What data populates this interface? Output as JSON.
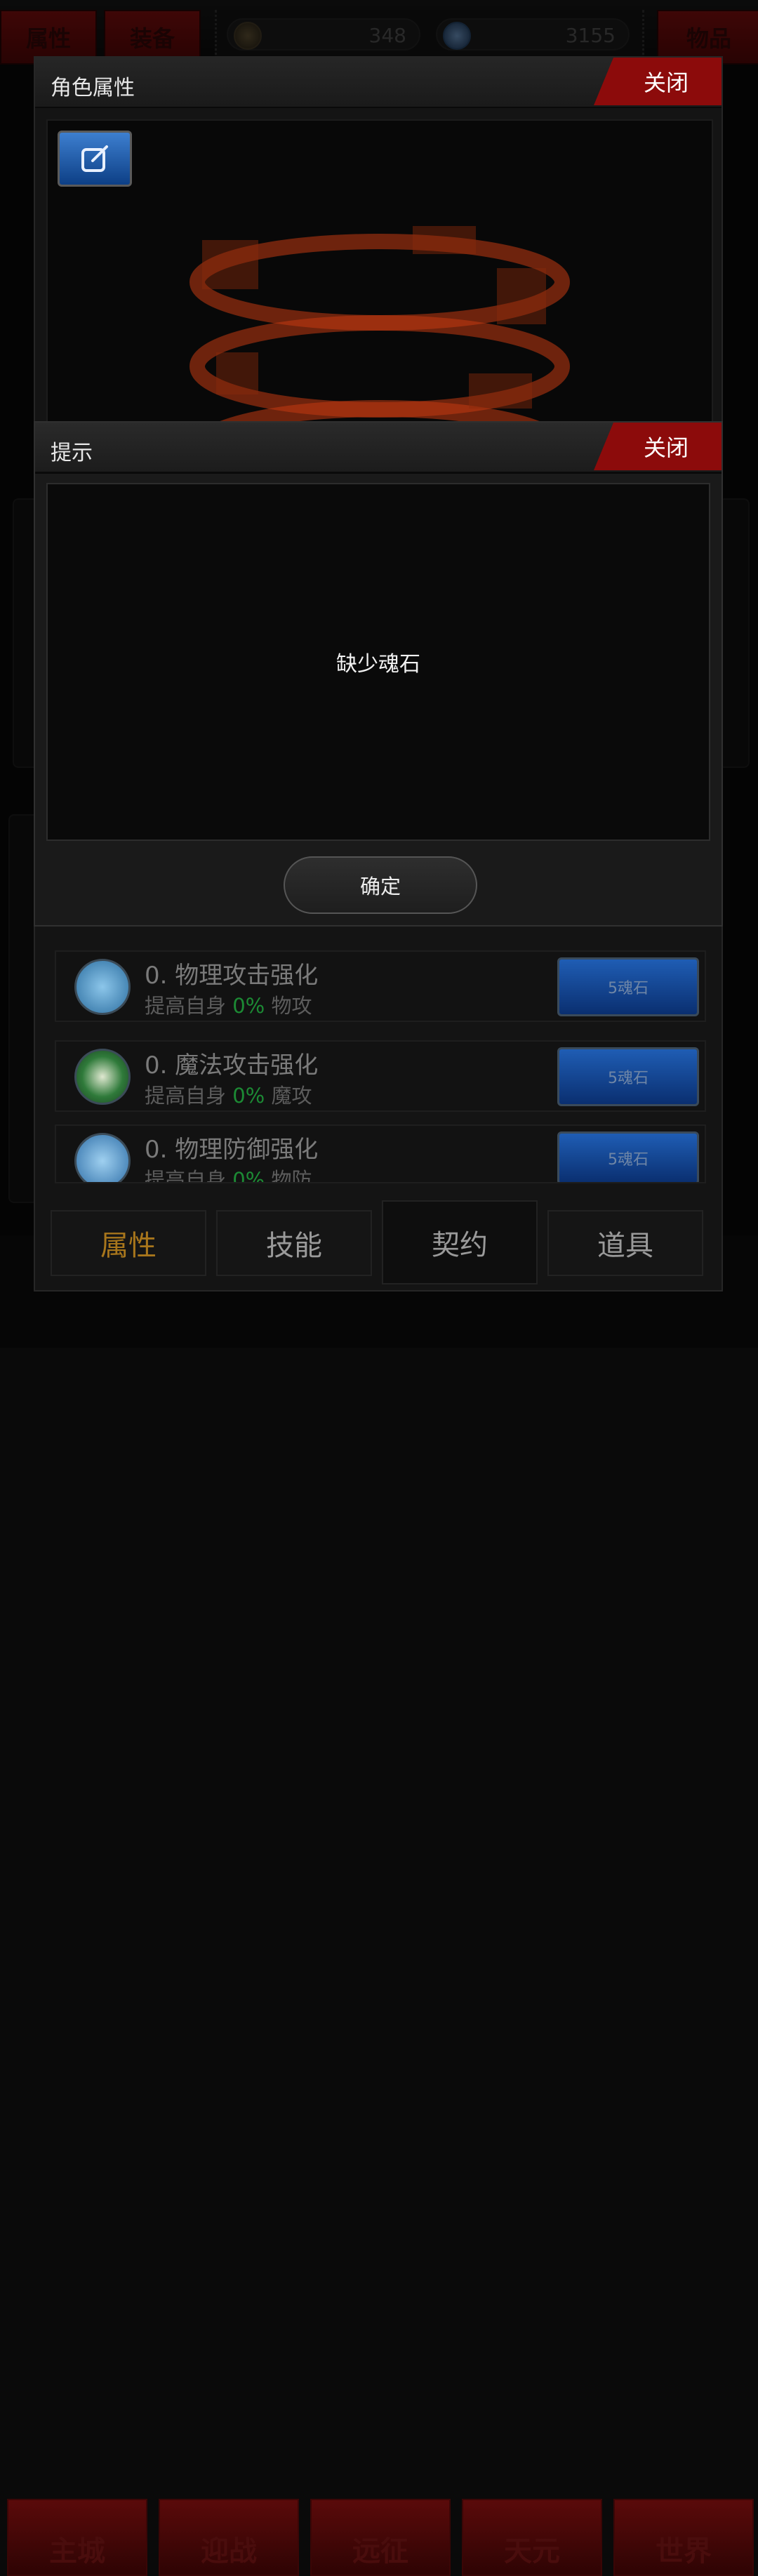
{
  "top_bar": {
    "attr_tab": "属性",
    "equip_tab": "装备",
    "items_tab": "物品",
    "currency_gold": "348",
    "currency_gem": "3155"
  },
  "bottom_nav": [
    "主城",
    "迎战",
    "远征",
    "天元",
    "世界"
  ],
  "panel": {
    "title": "角色属性",
    "close_label": "关闭",
    "edit_icon": "edit-icon"
  },
  "skills": [
    {
      "name": "0. 物理攻击强化",
      "prefix": "提高自身",
      "percent": "0%",
      "suffix": "物攻",
      "cost": "5魂石",
      "icon_color": "#3c7fb0"
    },
    {
      "name": "0. 魔法攻击强化",
      "prefix": "提高自身",
      "percent": "0%",
      "suffix": "魔攻",
      "cost": "5魂石",
      "icon_color": "#2f7a3a"
    },
    {
      "name": "0. 物理防御强化",
      "prefix": "提高自身",
      "percent": "0%",
      "suffix": "物防",
      "cost": "5魂石",
      "icon_color": "#2f6fa8"
    }
  ],
  "tabs": [
    "属性",
    "技能",
    "契约",
    "道具"
  ],
  "dialog": {
    "title": "提示",
    "close_label": "关闭",
    "message": "缺少魂石",
    "confirm": "确定"
  },
  "colors": {
    "accent_red": "#8c0b0b",
    "percent_green": "#1c8a34",
    "active_tab": "#a8761c",
    "cost_button_blue": "#1f5db4"
  }
}
